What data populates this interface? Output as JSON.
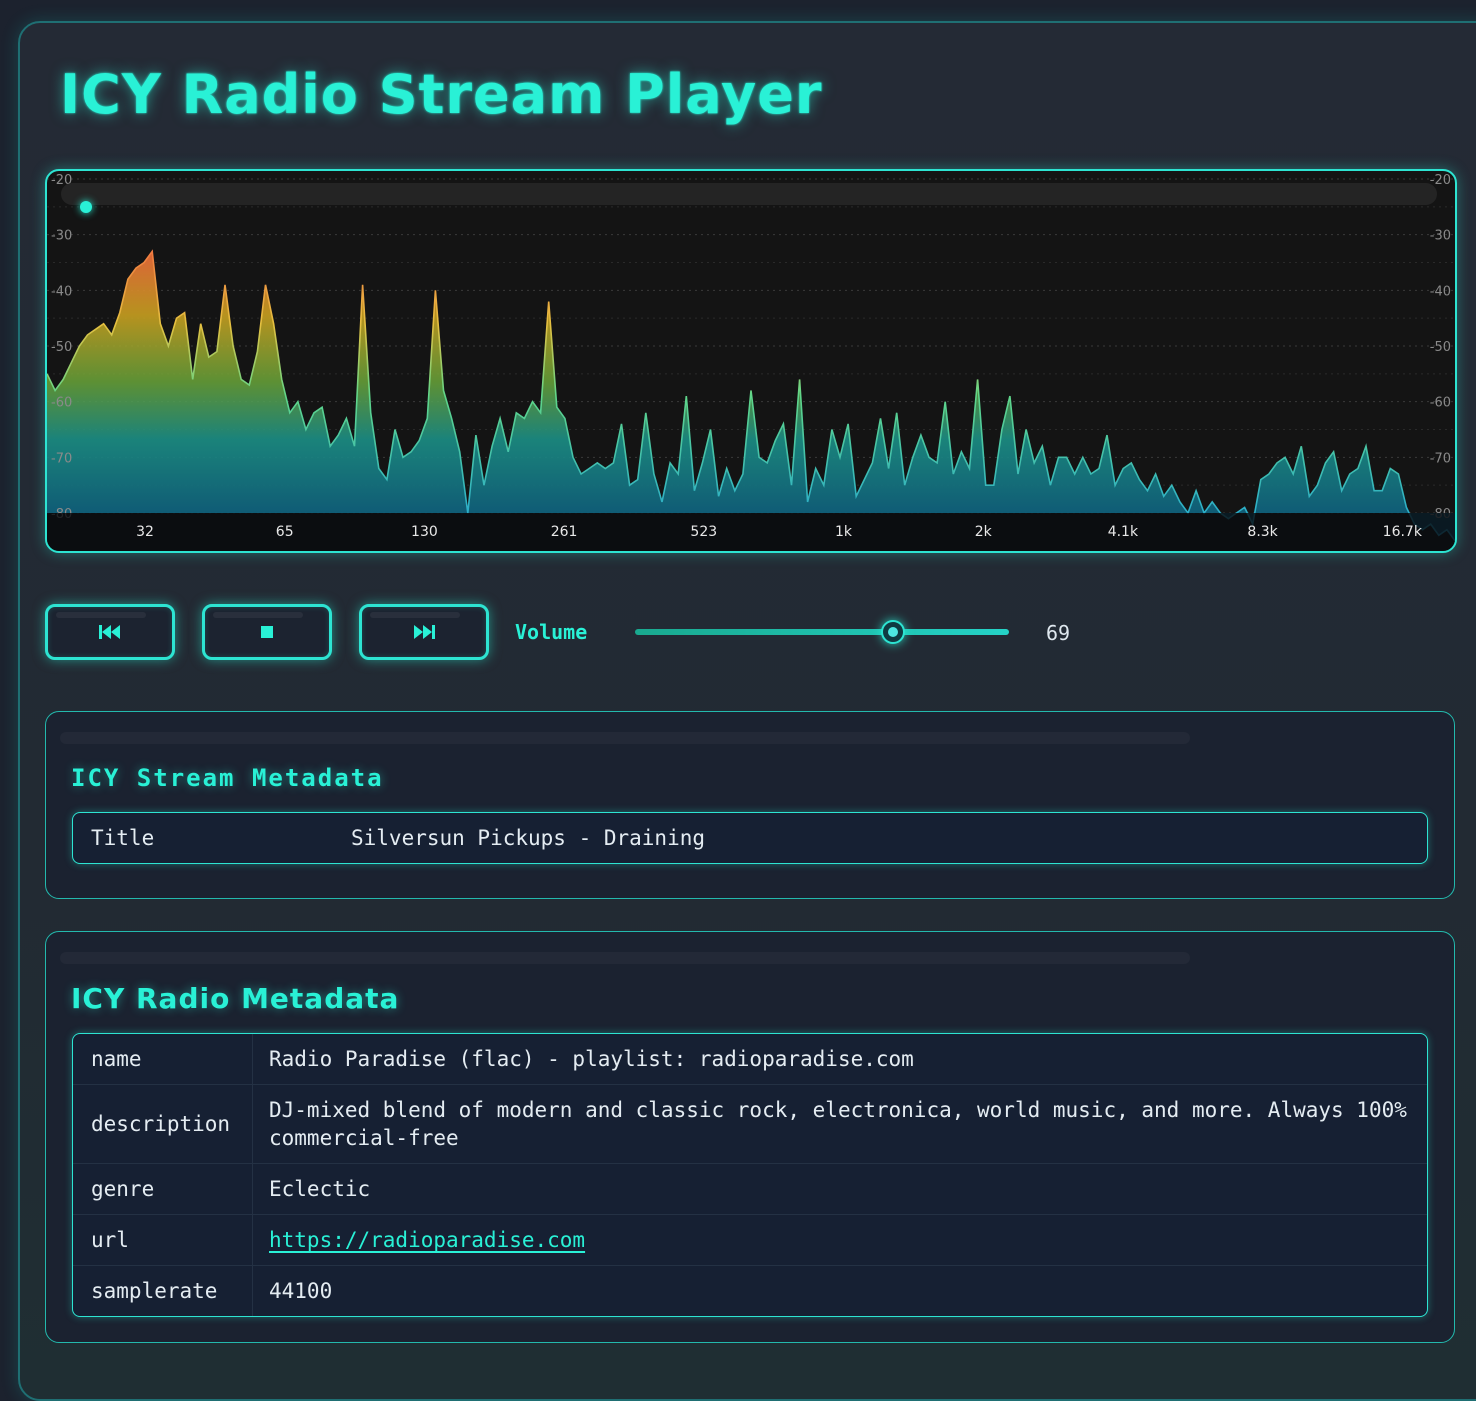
{
  "app": {
    "title": "ICY Radio Stream Player"
  },
  "visualizer": {
    "db_ticks": [
      "-20",
      "-30",
      "-40",
      "-50",
      "-60",
      "-70",
      "-80"
    ],
    "freq_ticks": [
      "32",
      "65",
      "130",
      "261",
      "523",
      "1k",
      "2k",
      "4.1k",
      "8.3k",
      "16.7k"
    ],
    "playback_progress": 0.01,
    "spectrum_db": [
      -55,
      -58,
      -56,
      -53,
      -50,
      -48,
      -47,
      -46,
      -48,
      -44,
      -38,
      -36,
      -35,
      -33,
      -46,
      -50,
      -45,
      -44,
      -56,
      -46,
      -52,
      -51,
      -39,
      -50,
      -56,
      -57,
      -51,
      -39,
      -46,
      -56,
      -62,
      -60,
      -65,
      -62,
      -61,
      -68,
      -66,
      -63,
      -68,
      -39,
      -62,
      -72,
      -74,
      -65,
      -70,
      -69,
      -67,
      -63,
      -40,
      -58,
      -63,
      -69,
      -80,
      -66,
      -75,
      -68,
      -63,
      -69,
      -62,
      -63,
      -60,
      -62,
      -42,
      -61,
      -63,
      -70,
      -73,
      -72,
      -71,
      -72,
      -71,
      -64,
      -75,
      -74,
      -62,
      -73,
      -78,
      -71,
      -73,
      -59,
      -76,
      -71,
      -65,
      -77,
      -72,
      -76,
      -73,
      -58,
      -70,
      -71,
      -67,
      -64,
      -75,
      -56,
      -78,
      -72,
      -75,
      -65,
      -70,
      -64,
      -77,
      -74,
      -71,
      -63,
      -72,
      -62,
      -75,
      -70,
      -66,
      -70,
      -71,
      -60,
      -73,
      -69,
      -72,
      -56,
      -75,
      -75,
      -65,
      -59,
      -73,
      -65,
      -71,
      -68,
      -75,
      -70,
      -70,
      -73,
      -70,
      -73,
      -72,
      -66,
      -75,
      -72,
      -71,
      -74,
      -76,
      -73,
      -77,
      -75,
      -78,
      -80,
      -76,
      -80,
      -78,
      -80,
      -81,
      -80,
      -79,
      -82,
      -74,
      -73,
      -71,
      -70,
      -73,
      -68,
      -77,
      -75,
      -71,
      -69,
      -76,
      -73,
      -72,
      -68,
      -76,
      -76,
      -72,
      -73,
      -79,
      -82,
      -83,
      -82,
      -84,
      -83,
      -85
    ]
  },
  "controls": {
    "prev_icon": "skip-back-icon",
    "stop_icon": "stop-icon",
    "next_icon": "skip-forward-icon",
    "volume_label": "Volume",
    "volume_value": "69",
    "volume_max": 100
  },
  "stream_metadata": {
    "heading": "ICY Stream Metadata",
    "rows": [
      {
        "key": "Title",
        "value": "Silversun Pickups - Draining"
      }
    ]
  },
  "radio_metadata": {
    "heading": "ICY Radio Metadata",
    "rows": [
      {
        "key": "name",
        "value": "Radio Paradise (flac) - playlist: radioparadise.com"
      },
      {
        "key": "description",
        "value": "DJ-mixed blend of modern and classic rock, electronica, world music, and more. Always 100% commercial-free"
      },
      {
        "key": "genre",
        "value": "Eclectic"
      },
      {
        "key": "url",
        "value": "https://radioparadise.com"
      },
      {
        "key": "samplerate",
        "value": "44100"
      }
    ]
  },
  "colors": {
    "accent": "#29f1d6",
    "background": "#1c222e",
    "spectrum_low": "#0d5a7a",
    "spectrum_mid": "#2ab38a",
    "spectrum_high": "#e0a030",
    "spectrum_peak": "#e8683a"
  }
}
